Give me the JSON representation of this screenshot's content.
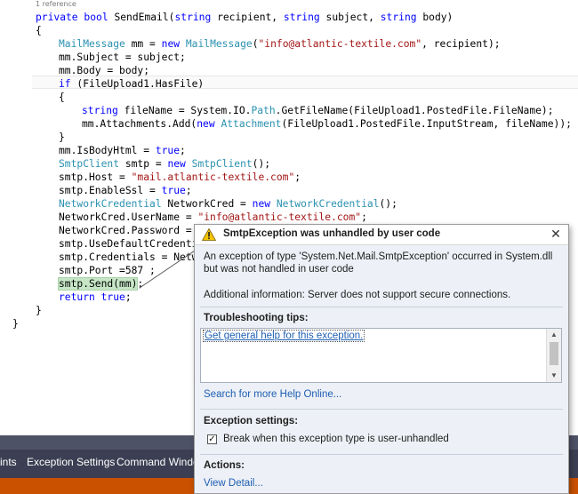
{
  "editor": {
    "codelens": "1 reference",
    "lines": [
      [
        {
          "c": "k",
          "t": "private"
        },
        {
          "c": "",
          "t": " "
        },
        {
          "c": "k",
          "t": "bool"
        },
        {
          "c": "",
          "t": " SendEmail("
        },
        {
          "c": "k",
          "t": "string"
        },
        {
          "c": "",
          "t": " recipient, "
        },
        {
          "c": "k",
          "t": "string"
        },
        {
          "c": "",
          "t": " subject, "
        },
        {
          "c": "k",
          "t": "string"
        },
        {
          "c": "",
          "t": " body)"
        }
      ],
      [
        {
          "c": "",
          "t": "{"
        }
      ],
      [
        {
          "c": "t",
          "t": "MailMessage"
        },
        {
          "c": "",
          "t": " mm = "
        },
        {
          "c": "k",
          "t": "new"
        },
        {
          "c": "",
          "t": " "
        },
        {
          "c": "t",
          "t": "MailMessage"
        },
        {
          "c": "",
          "t": "("
        },
        {
          "c": "s",
          "t": "\"info@atlantic-textile.com\""
        },
        {
          "c": "",
          "t": ", recipient);"
        }
      ],
      [
        {
          "c": "",
          "t": "mm.Subject = subject;"
        }
      ],
      [
        {
          "c": "",
          "t": "mm.Body = body;"
        }
      ],
      [
        {
          "c": "k",
          "t": "if"
        },
        {
          "c": "",
          "t": " (FileUpload1.HasFile)"
        }
      ],
      [
        {
          "c": "",
          "t": "{"
        }
      ],
      [
        {
          "c": "k",
          "t": "string"
        },
        {
          "c": "",
          "t": " fileName = System.IO."
        },
        {
          "c": "t",
          "t": "Path"
        },
        {
          "c": "",
          "t": ".GetFileName(FileUpload1.PostedFile.FileName);"
        }
      ],
      [
        {
          "c": "",
          "t": "mm.Attachments.Add("
        },
        {
          "c": "k",
          "t": "new"
        },
        {
          "c": "",
          "t": " "
        },
        {
          "c": "t",
          "t": "Attachment"
        },
        {
          "c": "",
          "t": "(FileUpload1.PostedFile.InputStream, fileName));"
        }
      ],
      [
        {
          "c": "",
          "t": "}"
        }
      ],
      [
        {
          "c": "",
          "t": "mm.IsBodyHtml = "
        },
        {
          "c": "k",
          "t": "true"
        },
        {
          "c": "",
          "t": ";"
        }
      ],
      [
        {
          "c": "t",
          "t": "SmtpClient"
        },
        {
          "c": "",
          "t": " smtp = "
        },
        {
          "c": "k",
          "t": "new"
        },
        {
          "c": "",
          "t": " "
        },
        {
          "c": "t",
          "t": "SmtpClient"
        },
        {
          "c": "",
          "t": "();"
        }
      ],
      [
        {
          "c": "",
          "t": "smtp.Host = "
        },
        {
          "c": "s",
          "t": "\"mail.atlantic-textile.com\""
        },
        {
          "c": "",
          "t": ";"
        }
      ],
      [
        {
          "c": "",
          "t": "smtp.EnableSsl = "
        },
        {
          "c": "k",
          "t": "true"
        },
        {
          "c": "",
          "t": ";"
        }
      ],
      [
        {
          "c": "t",
          "t": "NetworkCredential"
        },
        {
          "c": "",
          "t": " NetworkCred = "
        },
        {
          "c": "k",
          "t": "new"
        },
        {
          "c": "",
          "t": " "
        },
        {
          "c": "t",
          "t": "NetworkCredential"
        },
        {
          "c": "",
          "t": "();"
        }
      ],
      [
        {
          "c": "",
          "t": "NetworkCred.UserName = "
        },
        {
          "c": "s",
          "t": "\"info@atlantic-textile.com\""
        },
        {
          "c": "",
          "t": ";"
        }
      ],
      [
        {
          "c": "",
          "t": "NetworkCred.Password = "
        }
      ],
      [
        {
          "c": "",
          "t": "smtp.UseDefaultCredenti"
        }
      ],
      [
        {
          "c": "",
          "t": "smtp.Credentials = Netw"
        }
      ],
      [
        {
          "c": "",
          "t": "smtp.Port =587 ;"
        }
      ],
      [
        {
          "c": "hl",
          "t": "smtp.Send(mm)"
        },
        {
          "c": "",
          "t": ";"
        }
      ],
      [
        {
          "c": "k",
          "t": "return"
        },
        {
          "c": "",
          "t": " "
        },
        {
          "c": "k",
          "t": "true"
        },
        {
          "c": "",
          "t": ";"
        }
      ],
      [
        {
          "c": "",
          "t": "}"
        }
      ],
      [
        {
          "c": "",
          "t": "}"
        }
      ]
    ]
  },
  "tabs": {
    "items": [
      "ints",
      "Exception Settings",
      "Command Windo"
    ]
  },
  "exception": {
    "title": "SmtpException was unhandled by user code",
    "close_glyph": "✕",
    "description": "An exception of type 'System.Net.Mail.SmtpException' occurred in System.dll but was not handled in user code",
    "additional": "Additional information: Server does not support secure connections.",
    "troubleshooting_heading": "Troubleshooting tips:",
    "tips": [
      "Get general help for this exception."
    ],
    "search_link": "Search for more Help Online...",
    "exception_settings_heading": "Exception settings:",
    "break_label": "Break when this exception type is user-unhandled",
    "break_checked": true,
    "actions_heading": "Actions:",
    "view_detail": "View Detail..."
  },
  "colors": {
    "keyword": "#0000ff",
    "type": "#2b91af",
    "string": "#a31515",
    "statement_highlight": "#c6e6c6",
    "status_bar": "#ca5100",
    "tab_bar": "#3c3f53"
  }
}
